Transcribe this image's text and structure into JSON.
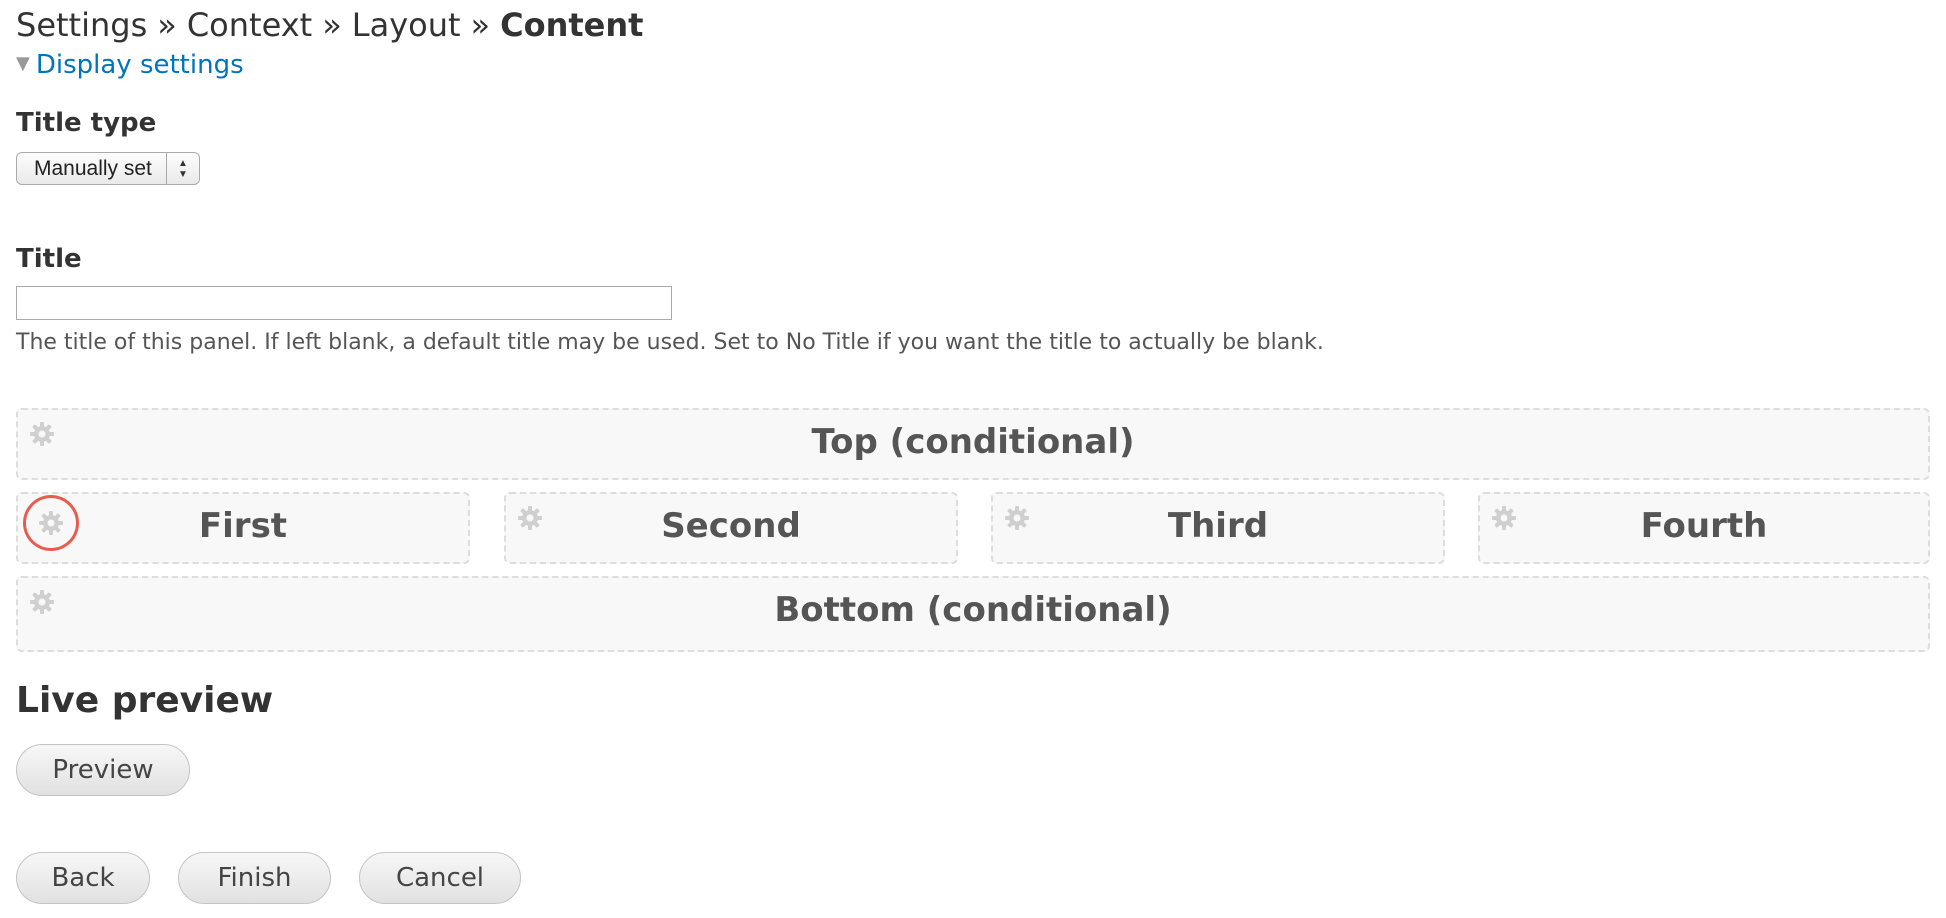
{
  "breadcrumb": {
    "items": [
      "Settings",
      "Context",
      "Layout"
    ],
    "separator": "»",
    "current": "Content"
  },
  "display_settings": {
    "label": "Display settings",
    "expanded": true
  },
  "title_type": {
    "label": "Title type",
    "selected": "Manually set"
  },
  "title_field": {
    "label": "Title",
    "value": "",
    "description": "The title of this panel. If left blank, a default title may be used. Set to No Title if you want the title to actually be blank."
  },
  "regions": {
    "top": "Top (conditional)",
    "first": "First",
    "second": "Second",
    "third": "Third",
    "fourth": "Fourth",
    "bottom": "Bottom (conditional)"
  },
  "live_preview": {
    "title": "Live preview",
    "preview_button": "Preview"
  },
  "actions": {
    "back": "Back",
    "finish": "Finish",
    "cancel": "Cancel"
  },
  "colors": {
    "link": "#0074bd",
    "highlight_ring": "#e85c4f"
  }
}
